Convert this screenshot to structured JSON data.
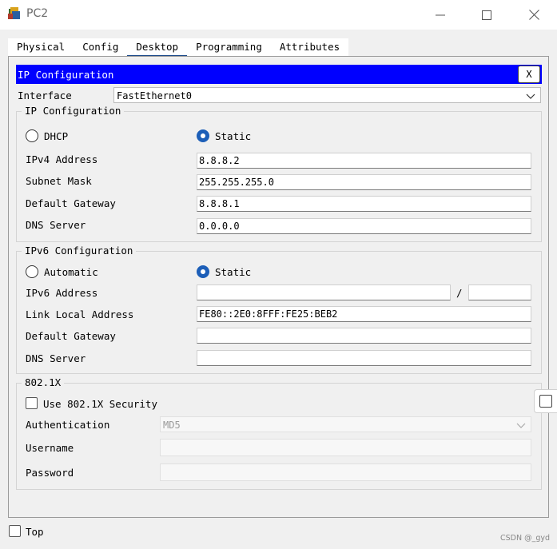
{
  "window": {
    "title": "PC2",
    "minimize_icon": "minimize-icon",
    "maximize_icon": "maximize-icon",
    "close_icon": "close-icon"
  },
  "tabs": [
    {
      "label": "Physical"
    },
    {
      "label": "Config"
    },
    {
      "label": "Desktop",
      "active": true
    },
    {
      "label": "Programming"
    },
    {
      "label": "Attributes"
    }
  ],
  "panel": {
    "title": "IP Configuration",
    "close_label": "X",
    "header_color": "#0000ff"
  },
  "interface": {
    "label": "Interface",
    "value": "FastEthernet0"
  },
  "ipv4": {
    "group_label": "IP Configuration",
    "dhcp_label": "DHCP",
    "static_label": "Static",
    "selected": "Static",
    "address_label": "IPv4 Address",
    "address_value": "8.8.8.2",
    "subnet_label": "Subnet Mask",
    "subnet_value": "255.255.255.0",
    "gateway_label": "Default Gateway",
    "gateway_value": "8.8.8.1",
    "dns_label": "DNS Server",
    "dns_value": "0.0.0.0"
  },
  "ipv6": {
    "group_label": "IPv6 Configuration",
    "auto_label": "Automatic",
    "static_label": "Static",
    "selected": "Static",
    "address_label": "IPv6 Address",
    "address_value": "",
    "prefix_separator": "/",
    "prefix_value": "",
    "link_local_label": "Link Local Address",
    "link_local_value": "FE80::2E0:8FFF:FE25:BEB2",
    "gateway_label": "Default Gateway",
    "gateway_value": "",
    "dns_label": "DNS Server",
    "dns_value": ""
  },
  "dot1x": {
    "group_label": "802.1X",
    "use_label": "Use 802.1X Security",
    "use_checked": false,
    "auth_label": "Authentication",
    "auth_value": "MD5",
    "username_label": "Username",
    "username_value": "",
    "password_label": "Password",
    "password_value": ""
  },
  "footer": {
    "top_label": "Top",
    "top_checked": false
  },
  "watermark": "CSDN @_gyd",
  "colors": {
    "accent": "#1d5fb8",
    "tab_underline": "#1b4a8a"
  }
}
